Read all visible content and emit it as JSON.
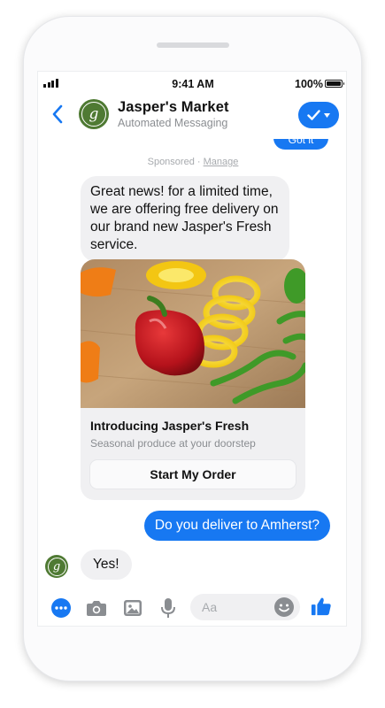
{
  "status_bar": {
    "time": "9:41 AM",
    "battery": "100%"
  },
  "header": {
    "title": "Jasper's Market",
    "subtitle": "Automated Messaging",
    "avatar_letter": "g"
  },
  "chat": {
    "previous_reply": "Got it",
    "sponsored_label": "Sponsored",
    "separator": "·",
    "manage_link": "Manage",
    "incoming_message": "Great news! for a limited time, we are offering free delivery on our brand new Jasper's Fresh service.",
    "card": {
      "title": "Introducing Jasper's Fresh",
      "subtitle": "Seasonal produce at your doorstep",
      "button_label": "Start My Order",
      "image_icon": "bell-peppers-image"
    },
    "outgoing_message": "Do you deliver to Amherst?",
    "reply_message": "Yes!"
  },
  "composer": {
    "placeholder": "Aa",
    "icons": [
      "more-icon",
      "camera-icon",
      "gallery-icon",
      "microphone-icon",
      "emoji-icon",
      "thumbs-up-icon"
    ]
  },
  "colors": {
    "accent": "#1778f2",
    "brand_green": "#4f7a33",
    "bubble_gray": "#f0f0f2"
  }
}
